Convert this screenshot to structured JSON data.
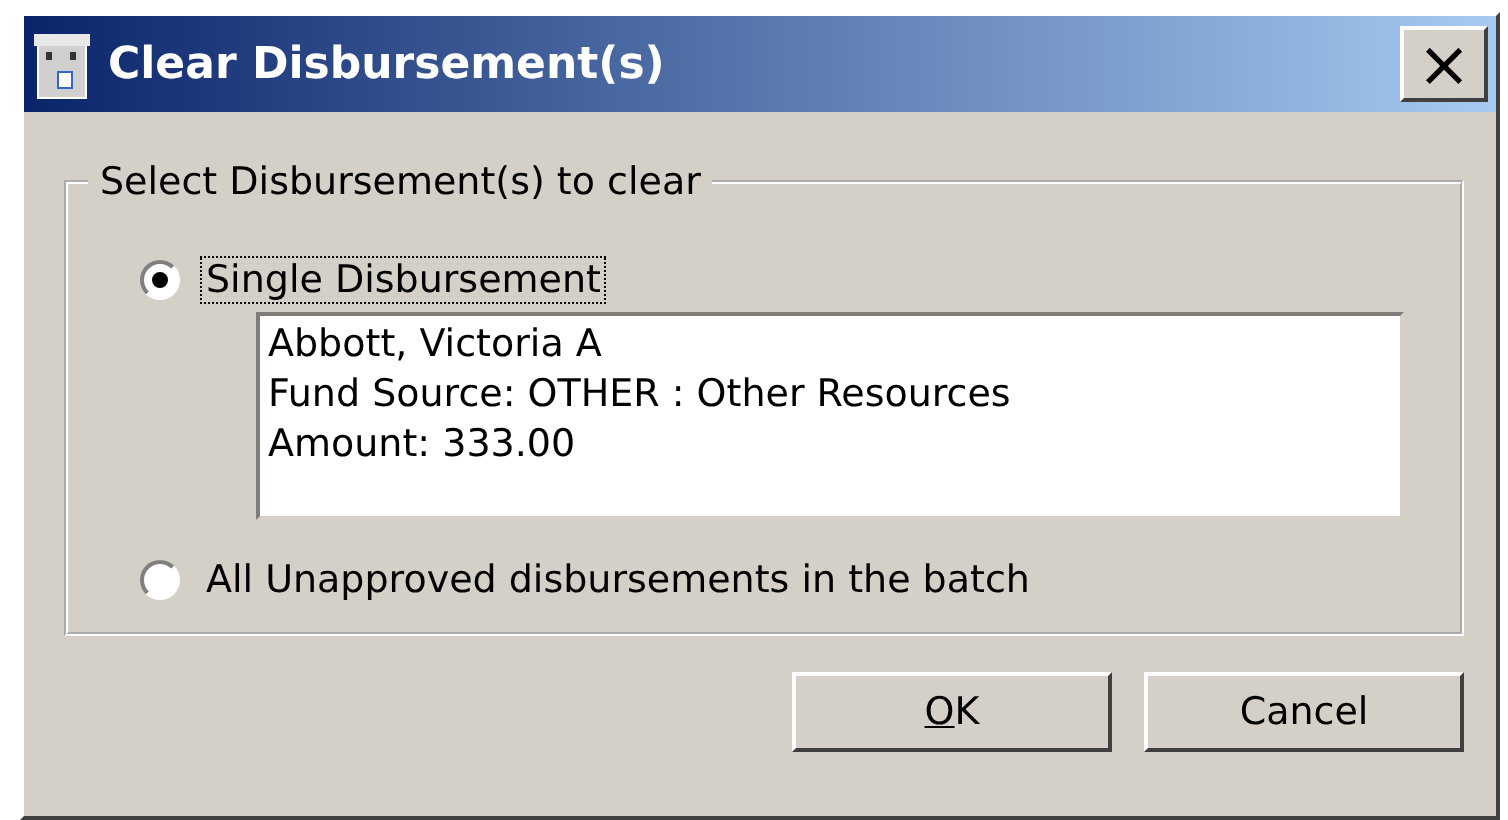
{
  "window": {
    "title": "Clear Disbursement(s)",
    "close": "×"
  },
  "group": {
    "label": "Select Disbursement(s) to clear",
    "options": [
      {
        "label": "Single Disbursement",
        "selected": true,
        "focused": true,
        "details": [
          "Abbott, Victoria A",
          "Fund Source: OTHER : Other Resources",
          "Amount: 333.00"
        ]
      },
      {
        "label": "All Unapproved disbursements in the batch",
        "selected": false,
        "focused": false
      }
    ]
  },
  "buttons": [
    {
      "label": "OK",
      "underline_first": true
    },
    {
      "label": "Cancel",
      "underline_first": false
    }
  ]
}
